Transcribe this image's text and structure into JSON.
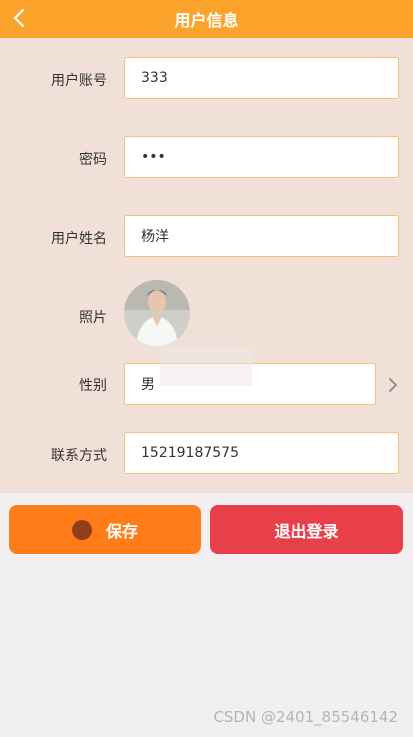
{
  "header": {
    "title": "用户信息",
    "back_icon": "chevron-left-icon"
  },
  "form": {
    "account": {
      "label": "用户账号",
      "value": "333"
    },
    "password": {
      "label": "密码",
      "value": "•••"
    },
    "name": {
      "label": "用户姓名",
      "value": "杨洋"
    },
    "photo": {
      "label": "照片"
    },
    "gender": {
      "label": "性别",
      "value": "男",
      "chevron_icon": "chevron-right-icon"
    },
    "contact": {
      "label": "联系方式",
      "value": "15219187575"
    }
  },
  "buttons": {
    "save": "保存",
    "logout": "退出登录"
  },
  "watermark": "CSDN @2401_85546142",
  "colors": {
    "header": "#fba32a",
    "form_bg": "#f1e0d7",
    "page_bg": "#f2eff1",
    "field_border": "#f3c27c",
    "save": "#fe7d18",
    "logout": "#e7404a"
  }
}
